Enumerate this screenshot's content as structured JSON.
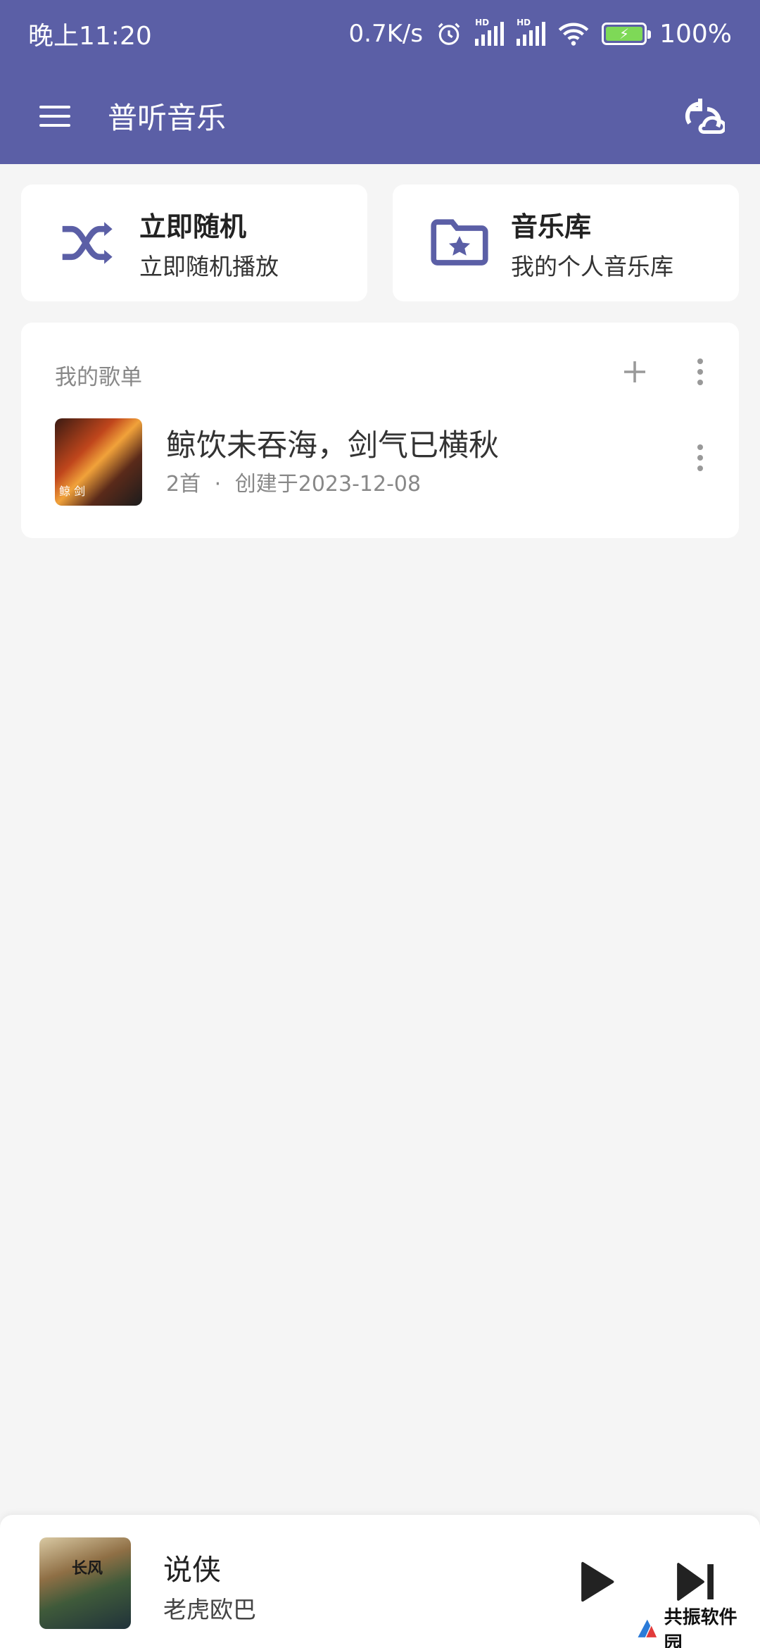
{
  "theme": {
    "primary": "#5b5fa6",
    "card_icon": "#5b5fa6"
  },
  "status": {
    "time": "晚上11:20",
    "speed": "0.7K/s",
    "hd1": "HD",
    "hd2": "HD",
    "battery": "100%"
  },
  "appbar": {
    "title": "普听音乐",
    "menu_icon": "menu-icon",
    "sync_icon": "sync-icon"
  },
  "quick": {
    "shuffle": {
      "title": "立即随机",
      "subtitle": "立即随机播放"
    },
    "library": {
      "title": "音乐库",
      "subtitle": "我的个人音乐库"
    }
  },
  "playlists": {
    "header": "我的歌单",
    "items": [
      {
        "name": "鲸饮未吞海，剑气已横秋",
        "count": "2首",
        "sep": "·",
        "created": "创建于2023-12-08"
      }
    ]
  },
  "now_playing": {
    "title": "说侠",
    "artist": "老虎欧巴"
  },
  "watermark": {
    "text": "共振软件园"
  }
}
